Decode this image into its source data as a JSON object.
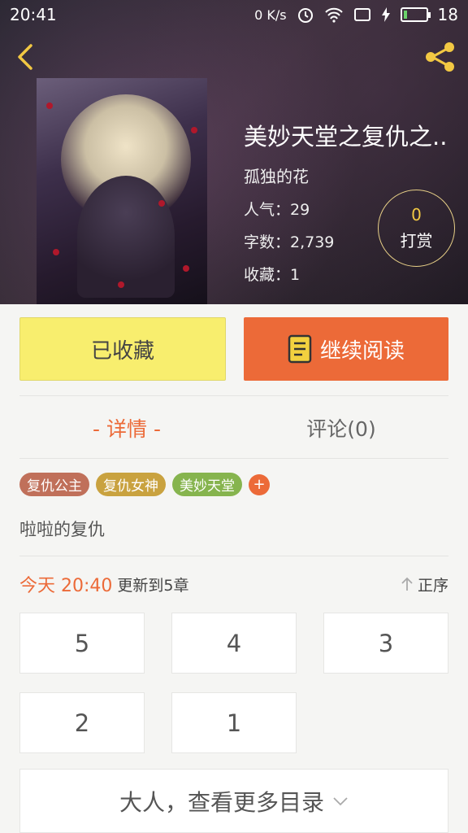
{
  "status_bar": {
    "time": "20:41",
    "network_speed": "0 K/s",
    "battery_level": "18"
  },
  "book": {
    "title": "美妙天堂之复仇之..",
    "author": "孤独的花",
    "popularity_label": "人气：29",
    "word_count_label": "字数：2,739",
    "favorites_label": "收藏：1"
  },
  "reward": {
    "count": "0",
    "label": "打赏"
  },
  "actions": {
    "collected_label": "已收藏",
    "continue_label": "继续阅读"
  },
  "tabs": [
    {
      "label": "- 详情 -",
      "active": true
    },
    {
      "label": "评论(0)",
      "active": false
    }
  ],
  "tags": [
    {
      "label": "复仇公主",
      "color": "#c0705a"
    },
    {
      "label": "复仇女神",
      "color": "#c9a23f"
    },
    {
      "label": "美妙天堂",
      "color": "#86b44e"
    }
  ],
  "tag_add_label": "+",
  "description": "啦啦的复仇",
  "update": {
    "time": "今天 20:40",
    "text": "更新到5章",
    "sort_label": "正序"
  },
  "chapters": [
    "5",
    "4",
    "3",
    "2",
    "1"
  ],
  "more_label": "大人，查看更多目录",
  "colors": {
    "accent": "#ec6a38",
    "collected_bg": "#f8ee6e",
    "reward_border": "#e7cf87"
  }
}
